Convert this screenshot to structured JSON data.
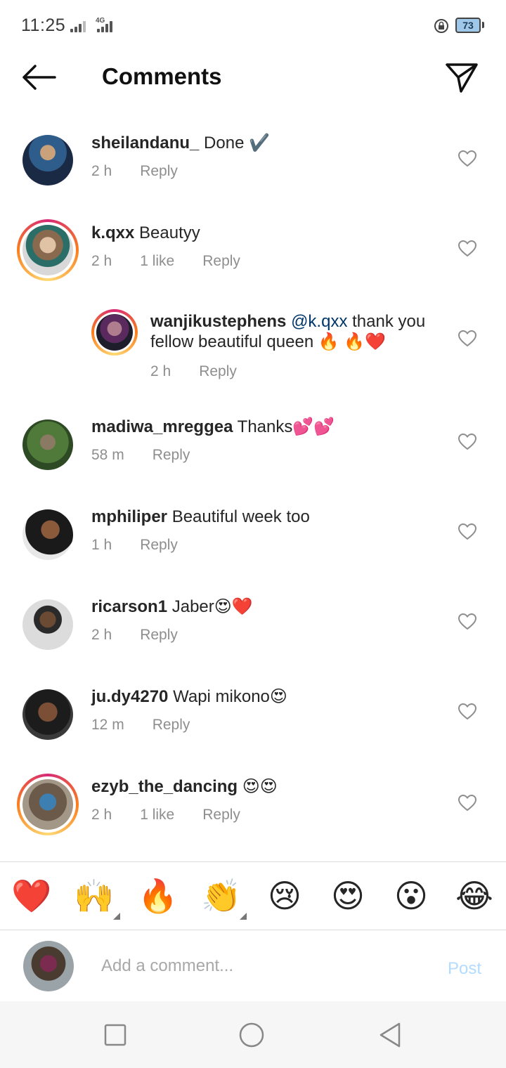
{
  "status_bar": {
    "time": "11:25",
    "network": "4G",
    "battery": "73"
  },
  "header": {
    "title": "Comments"
  },
  "comments": [
    {
      "username": "sheilandanu_",
      "text": "Done ✔️",
      "time": "2 h",
      "likes": "",
      "reply": "Reply",
      "story_ring": false
    },
    {
      "username": "k.qxx",
      "text": "Beautyy",
      "time": "2 h",
      "likes": "1 like",
      "reply": "Reply",
      "story_ring": true
    },
    {
      "username": "wanjikustephens",
      "mention": "@k.qxx",
      "text": "thank you fellow beautiful queen 🔥 🔥❤️",
      "time": "2 h",
      "likes": "",
      "reply": "Reply",
      "story_ring": true,
      "is_reply": true
    },
    {
      "username": "madiwa_mreggea",
      "text": "Thanks💕💕",
      "time": "58 m",
      "likes": "",
      "reply": "Reply",
      "story_ring": false
    },
    {
      "username": "mphiliper",
      "text": "Beautiful week too",
      "time": "1 h",
      "likes": "",
      "reply": "Reply",
      "story_ring": false
    },
    {
      "username": "ricarson1",
      "text": "Jaber😍❤️",
      "time": "2 h",
      "likes": "",
      "reply": "Reply",
      "story_ring": false
    },
    {
      "username": "ju.dy4270",
      "text": "Wapi mikono😍",
      "time": "12 m",
      "likes": "",
      "reply": "Reply",
      "story_ring": false
    },
    {
      "username": "ezyb_the_dancing",
      "text": "😍😍",
      "time": "2 h",
      "likes": "1 like",
      "reply": "Reply",
      "story_ring": true
    }
  ],
  "emoji_bar": [
    "❤️",
    "🙌",
    "🔥",
    "👏",
    "😢",
    "😍",
    "😮",
    "😂"
  ],
  "add_comment": {
    "placeholder": "Add a comment...",
    "post_label": "Post"
  },
  "colors": {
    "link": "#00376b",
    "post_disabled": "#b3dbff",
    "muted": "#8e8e8e"
  }
}
